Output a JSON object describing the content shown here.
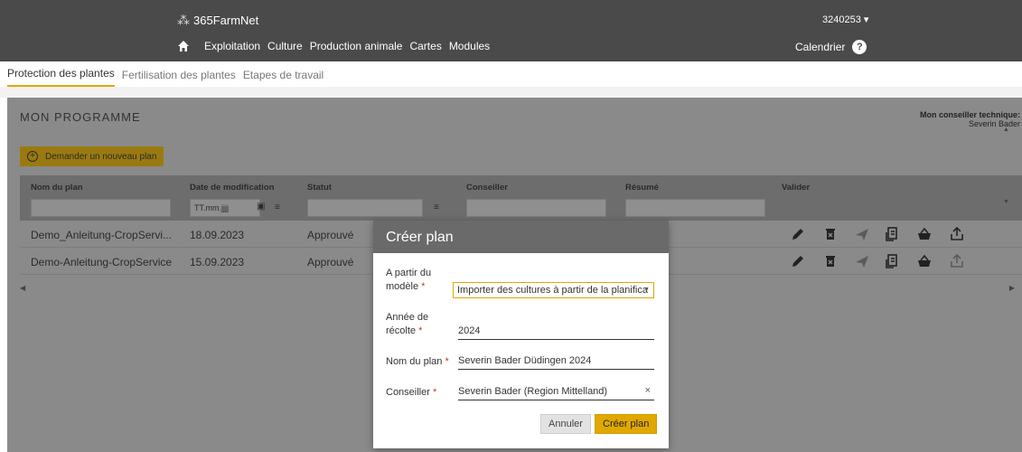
{
  "topbar": {
    "brand": "365FarmNet",
    "account": "3240253 ▾",
    "nav": [
      "Exploitation",
      "Culture",
      "Production animale",
      "Cartes",
      "Modules"
    ],
    "calendar": "Calendrier",
    "help": "?"
  },
  "subnav": {
    "tabs": [
      "Protection des plantes",
      "Fertilisation des plantes",
      "Etapes de travail"
    ],
    "active": 0
  },
  "program": {
    "title": "MON PROGRAMME",
    "advisor_label": "Mon conseiller technique:",
    "advisor_name": "Severin Bader",
    "new_plan_button": "Demander un nouveau plan"
  },
  "table": {
    "columns": [
      "Nom du plan",
      "Date de modification",
      "Statut",
      "Conseiller",
      "Résumé",
      "Valider"
    ],
    "date_filter_placeholder": "TT.mm.jjjj",
    "rows": [
      {
        "name": "Demo_Anleitung-CropServi...",
        "date": "18.09.2023",
        "status": "Approuvé"
      },
      {
        "name": "Demo-Anleitung-CropService",
        "date": "15.09.2023",
        "status": "Approuvé"
      }
    ]
  },
  "modal": {
    "title": "Créer plan",
    "fields": [
      {
        "label_line1": "A partir du",
        "label_line2": "modèle",
        "value": "Importer des cultures à partir de la planifica"
      },
      {
        "label_line1": "Année de",
        "label_line2": "récolte",
        "value": "2024"
      },
      {
        "label_line1": "Nom du plan",
        "value": "Severin Bader Düdingen 2024"
      },
      {
        "label_line1": "Conseiller",
        "value": "Severin Bader (Region Mittelland)"
      }
    ],
    "required_mark": "*",
    "cancel": "Annuler",
    "create": "Créer plan"
  },
  "colors": {
    "topbar": "#4a4a4a",
    "accent": "#e0a800",
    "overlay": "#8a8a8a"
  }
}
